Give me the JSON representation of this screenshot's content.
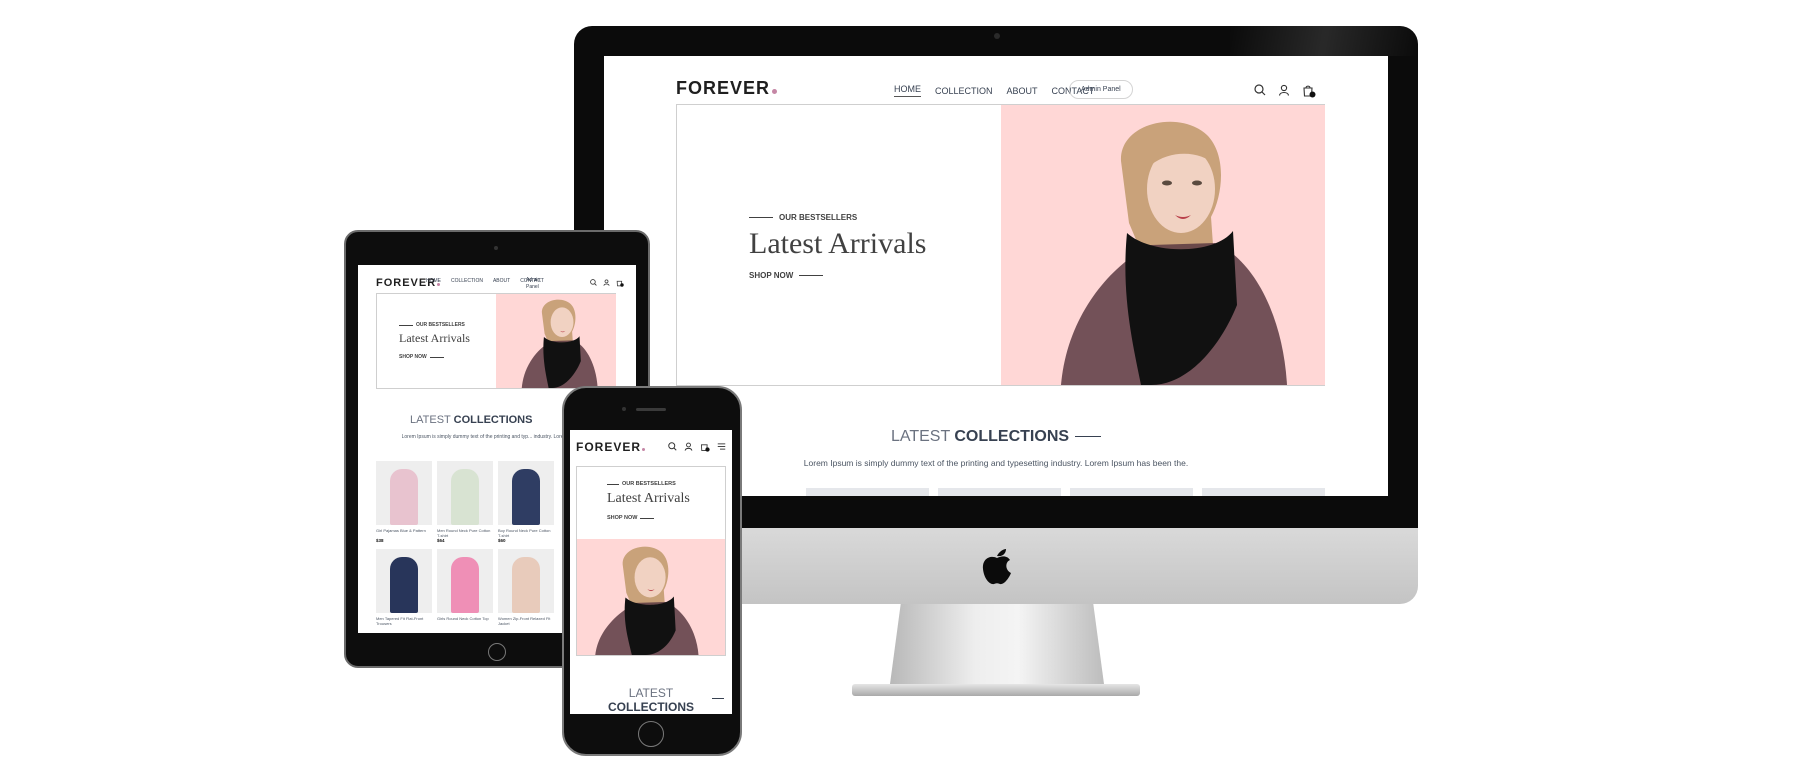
{
  "site": {
    "logo": "FOREVER",
    "nav": [
      "HOME",
      "COLLECTION",
      "ABOUT",
      "CONTACT"
    ],
    "admin_button": "Admin Panel",
    "cart_count": "0",
    "hero": {
      "eyebrow": "OUR BESTSELLERS",
      "title": "Latest Arrivals",
      "cta": "SHOP NOW"
    },
    "collections": {
      "title_light": "LATEST",
      "title_bold": "COLLECTIONS",
      "description": "Lorem Ipsum is simply dummy text of the printing and typesetting industry. Lorem Ipsum has been the."
    }
  },
  "tablet": {
    "description": "Lorem Ipsum is simply dummy text of the printing and typ... industry. Lorem Ipsum has been the.",
    "products": [
      {
        "name": "Girl Pajamas Blue & Pattern",
        "price": "$38",
        "tone": "#e8c3cf"
      },
      {
        "name": "Men Round Neck Pure Cotton T-shirt",
        "price": "$64",
        "tone": "#d8e3d2"
      },
      {
        "name": "Boy Round Neck Pure Cotton T-shirt",
        "price": "$60",
        "tone": "#2f3d63"
      },
      {
        "name": "Men Tapered Fit Flat-Front Trousers",
        "price": "",
        "tone": "#28355a"
      },
      {
        "name": "Girls Round Neck Cotton Top",
        "price": "",
        "tone": "#ef8fb6"
      },
      {
        "name": "Women Zip-Front Relaxed Fit Jacket",
        "price": "",
        "tone": "#e8cbbb"
      }
    ]
  },
  "colors": {
    "hero_pink": "#ffd7d6",
    "logo_dot": "#c586a5",
    "text_dark": "#374151"
  }
}
